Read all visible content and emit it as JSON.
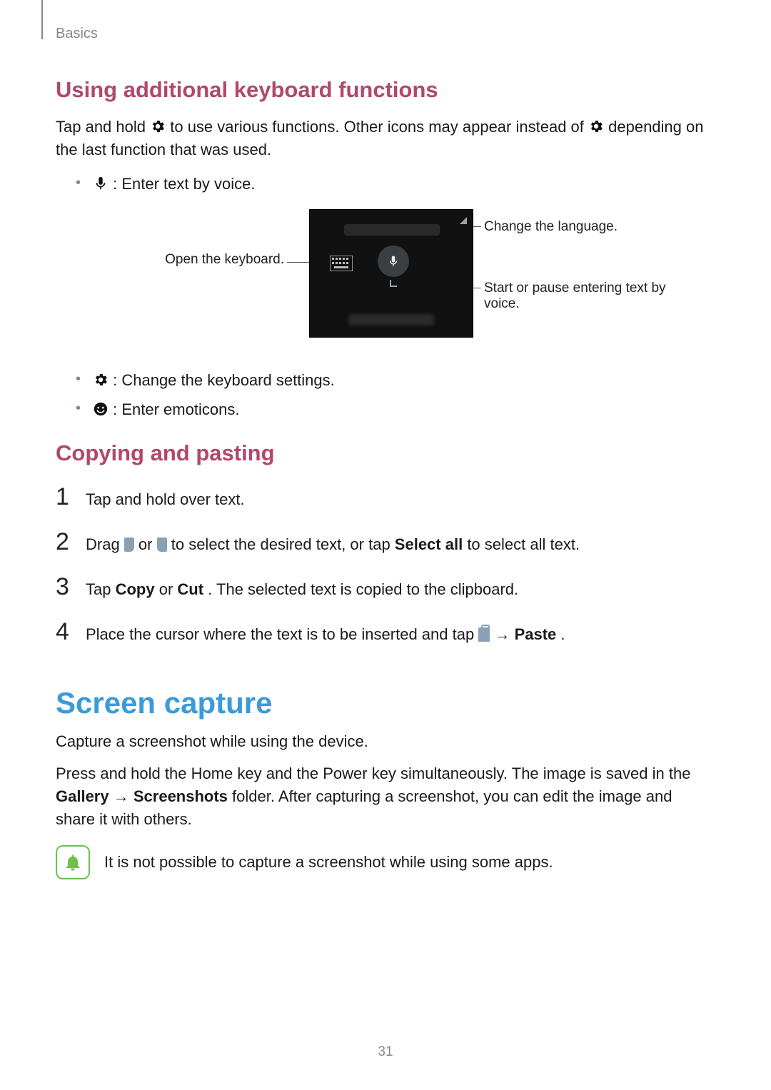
{
  "header": {
    "section": "Basics"
  },
  "s1": {
    "title": "Using additional keyboard functions",
    "intro_a": "Tap and hold ",
    "intro_b": " to use various functions. Other icons may appear instead of ",
    "intro_c": " depending on the last function that was used.",
    "bullet_voice": " : Enter text by voice.",
    "dia_open_kbd": "Open the keyboard.",
    "dia_change_lang": "Change the language.",
    "dia_start_pause": "Start or pause entering text by voice.",
    "bullet_settings": " : Change the keyboard settings.",
    "bullet_emoticons": " : Enter emoticons."
  },
  "s2": {
    "title": "Copying and pasting",
    "n1": "Tap and hold over text.",
    "n2_a": "Drag ",
    "n2_b": " or ",
    "n2_c": " to select the desired text, or tap ",
    "n2_select_all": "Select all",
    "n2_d": " to select all text.",
    "n3_a": "Tap ",
    "n3_copy": "Copy",
    "n3_b": " or ",
    "n3_cut": "Cut",
    "n3_c": ". The selected text is copied to the clipboard.",
    "n4_a": "Place the cursor where the text is to be inserted and tap ",
    "n4_arrow": " → ",
    "n4_paste": "Paste",
    "n4_b": "."
  },
  "s3": {
    "title": "Screen capture",
    "p1": "Capture a screenshot while using the device.",
    "p2_a": "Press and hold the Home key and the Power key simultaneously. The image is saved in the ",
    "p2_gallery": "Gallery",
    "p2_arrow": " → ",
    "p2_screenshots": "Screenshots",
    "p2_b": " folder. After capturing a screenshot, you can edit the image and share it with others.",
    "note": "It is not possible to capture a screenshot while using some apps."
  },
  "page": "31"
}
